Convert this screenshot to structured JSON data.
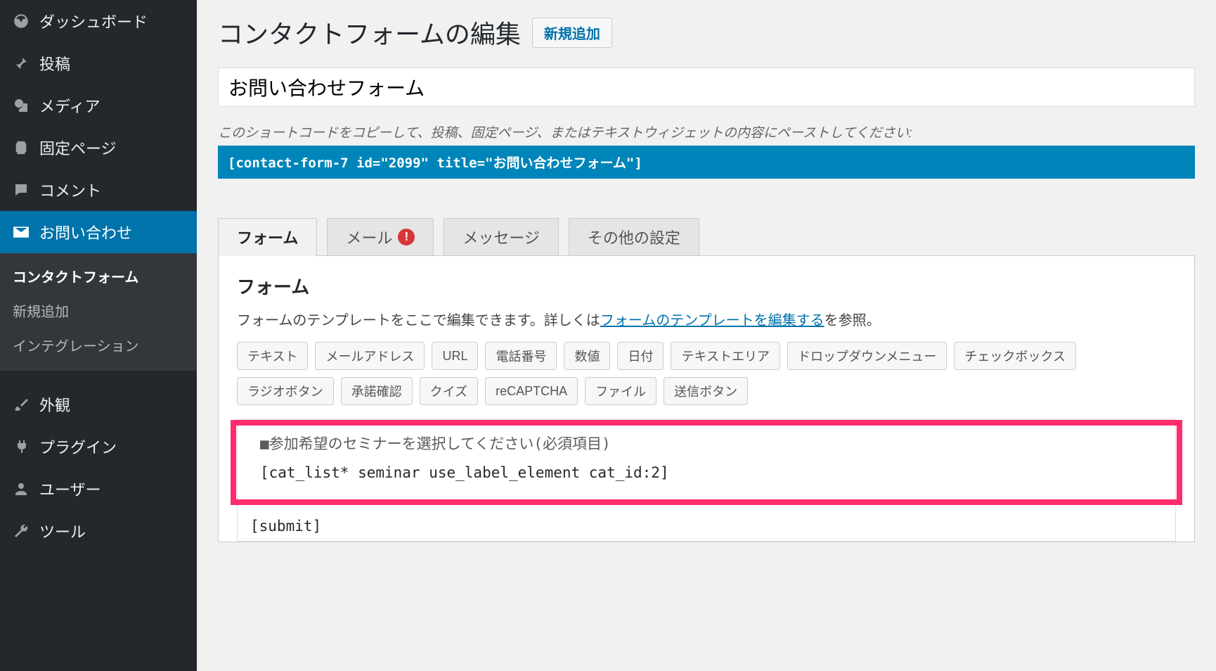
{
  "sidebar": {
    "items": [
      {
        "icon": "dashboard",
        "label": "ダッシュボード"
      },
      {
        "icon": "pin",
        "label": "投稿"
      },
      {
        "icon": "media",
        "label": "メディア"
      },
      {
        "icon": "page",
        "label": "固定ページ"
      },
      {
        "icon": "comment",
        "label": "コメント"
      },
      {
        "icon": "mail",
        "label": "お問い合わせ",
        "current": true
      },
      {
        "icon": "brush",
        "label": "外観"
      },
      {
        "icon": "plugin",
        "label": "プラグイン"
      },
      {
        "icon": "user",
        "label": "ユーザー"
      },
      {
        "icon": "wrench",
        "label": "ツール"
      }
    ],
    "submenu": [
      {
        "label": "コンタクトフォーム",
        "current": true
      },
      {
        "label": "新規追加"
      },
      {
        "label": "インテグレーション"
      }
    ]
  },
  "page": {
    "title": "コンタクトフォームの編集",
    "new_button": "新規追加",
    "form_title": "お問い合わせフォーム",
    "shortcode_note": "このショートコードをコピーして、投稿、固定ページ、またはテキストウィジェットの内容にペーストしてください:",
    "shortcode": "[contact-form-7 id=\"2099\" title=\"お問い合わせフォーム\"]"
  },
  "tabs": [
    {
      "label": "フォーム",
      "active": true
    },
    {
      "label": "メール",
      "alert": "!"
    },
    {
      "label": "メッセージ"
    },
    {
      "label": "その他の設定"
    }
  ],
  "form_panel": {
    "heading": "フォーム",
    "description_prefix": "フォームのテンプレートをここで編集できます。詳しくは",
    "description_link": "フォームのテンプレートを編集する",
    "description_suffix": "を参照。",
    "tag_buttons": [
      "テキスト",
      "メールアドレス",
      "URL",
      "電話番号",
      "数値",
      "日付",
      "テキストエリア",
      "ドロップダウンメニュー",
      "チェックボックス",
      "ラジオボタン",
      "承諾確認",
      "クイズ",
      "reCAPTCHA",
      "ファイル",
      "送信ボタン"
    ],
    "editor_lines": {
      "label_line": "■参加希望のセミナーを選択してください(必須項目)",
      "catlist_line": "[cat_list* seminar use_label_element cat_id:2]",
      "submit_line": "[submit]"
    }
  }
}
